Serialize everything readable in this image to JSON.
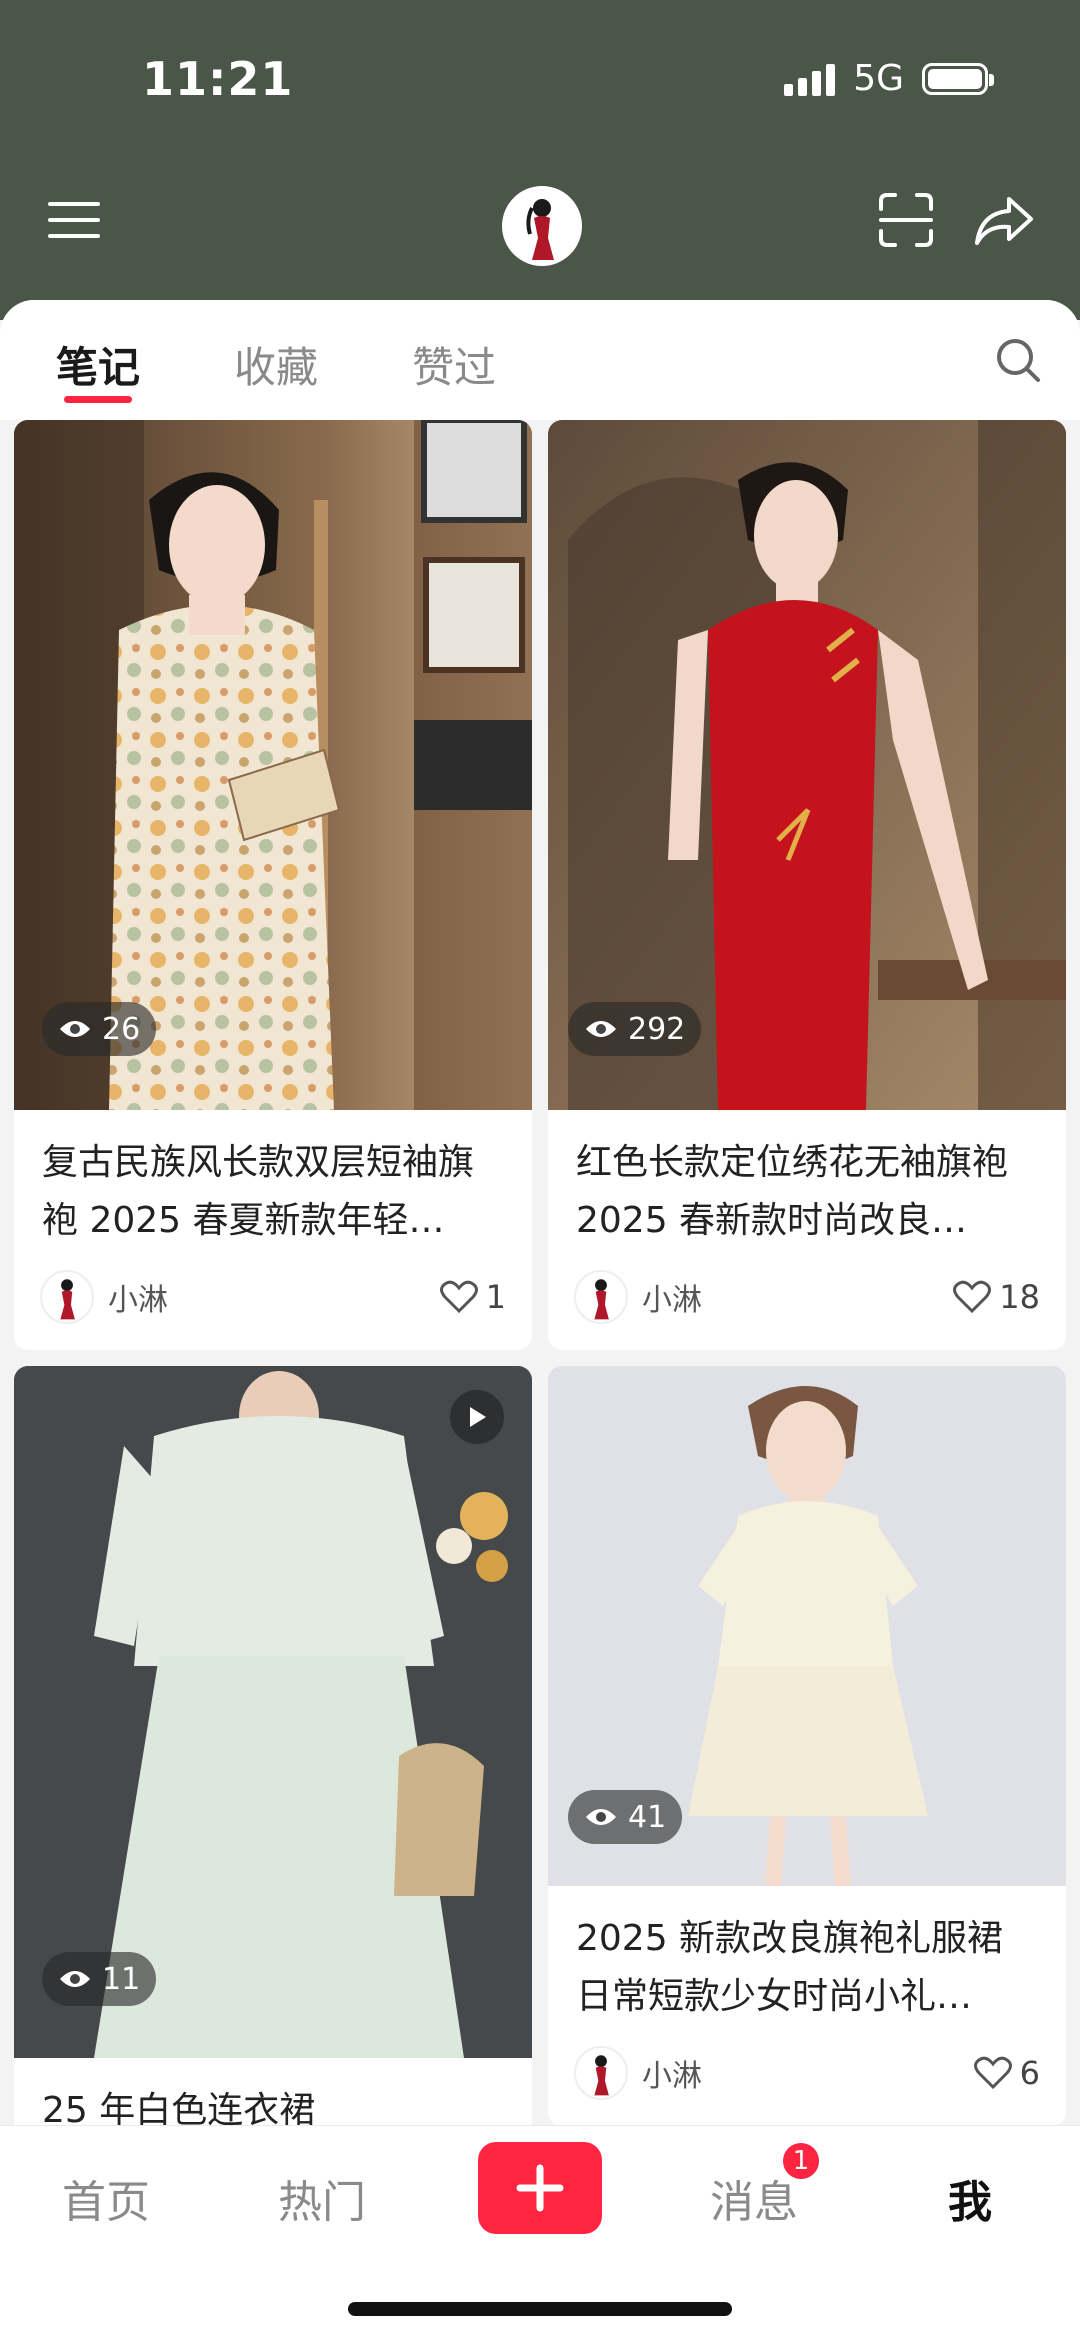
{
  "status_bar": {
    "time": "11:21",
    "network": "5G"
  },
  "profile_header": {
    "menu_icon": "hamburger-menu-icon",
    "scan_icon": "scan-icon",
    "share_icon": "share-arrow-icon"
  },
  "tabs": [
    {
      "label": "笔记",
      "active": true
    },
    {
      "label": "收藏",
      "active": false
    },
    {
      "label": "赞过",
      "active": false
    }
  ],
  "colors": {
    "header_bg": "#4a5647",
    "accent": "#ff2442"
  },
  "posts": [
    {
      "title": "复古民族风长款双层短袖旗袍 2025 春夏新款年轻…",
      "views": "26",
      "author": "小淋",
      "likes": "1",
      "is_video": false
    },
    {
      "title": "红色长款定位绣花无袖旗袍 2025 春新款时尚改良…",
      "views": "292",
      "author": "小淋",
      "likes": "18",
      "is_video": false
    },
    {
      "title": "25 年白色连衣裙",
      "views": "11",
      "author": "",
      "likes": "",
      "is_video": true
    },
    {
      "title": "2025 新款改良旗袍礼服裙日常短款少女时尚小礼…",
      "views": "41",
      "author": "小淋",
      "likes": "6",
      "is_video": false
    }
  ],
  "bottom_nav": {
    "home": "首页",
    "trending": "热门",
    "messages": "消息",
    "messages_badge": "1",
    "me": "我"
  }
}
